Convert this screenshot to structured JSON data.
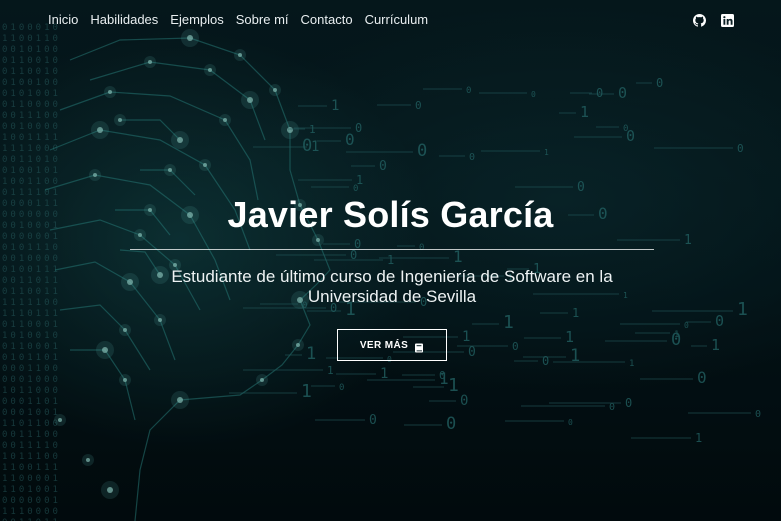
{
  "nav": {
    "links": [
      {
        "label": "Inicio",
        "name": "nav-link-inicio"
      },
      {
        "label": "Habilidades",
        "name": "nav-link-habilidades"
      },
      {
        "label": "Ejemplos",
        "name": "nav-link-ejemplos"
      },
      {
        "label": "Sobre mí",
        "name": "nav-link-sobre-mi"
      },
      {
        "label": "Contacto",
        "name": "nav-link-contacto"
      },
      {
        "label": "Currículum",
        "name": "nav-link-curriculum"
      }
    ],
    "social": [
      {
        "icon": "github-icon"
      },
      {
        "icon": "linkedin-icon"
      }
    ]
  },
  "hero": {
    "title": "Javier Solís García",
    "subtitle_line1": "Estudiante de último curso de Ingeniería de Software en la",
    "subtitle_line2": "Universidad de Sevilla",
    "cta_label": "VER MÁS",
    "cta_icon": "book-icon"
  },
  "theme": {
    "background": "#05181d",
    "accent": "#1f7f7f",
    "text": "#ffffff"
  }
}
